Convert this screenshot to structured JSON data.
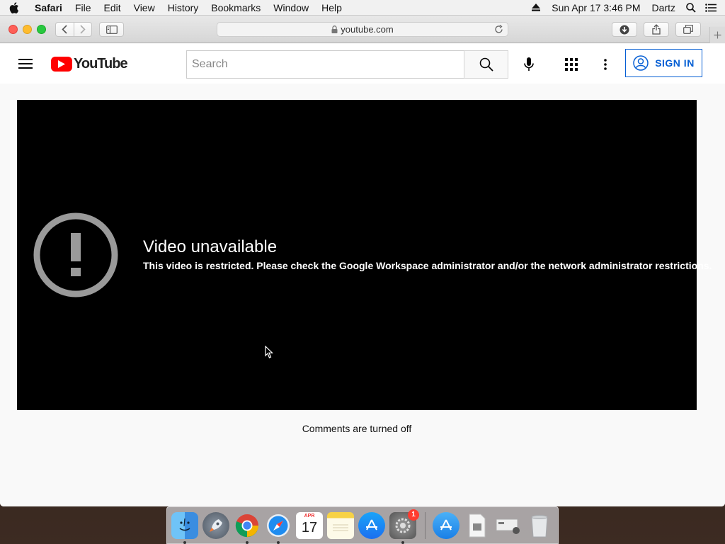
{
  "menubar": {
    "app_name": "Safari",
    "items": [
      "File",
      "Edit",
      "View",
      "History",
      "Bookmarks",
      "Window",
      "Help"
    ],
    "datetime": "Sun Apr 17  3:46 PM",
    "user": "Dartz",
    "icons": [
      "apple-icon",
      "eject-icon",
      "spotlight-icon",
      "notification-center-icon"
    ]
  },
  "browser": {
    "url": "youtube.com",
    "toolbar_icons": [
      "back-icon",
      "forward-icon",
      "sidebar-icon",
      "lock-icon",
      "reload-icon",
      "download-icon",
      "share-icon",
      "tabs-icon",
      "new-tab-icon"
    ]
  },
  "youtube": {
    "logo_text": "YouTube",
    "search_placeholder": "Search",
    "signin_label": "SIGN IN",
    "brand_color": "#ff0000",
    "link_color": "#065fd4"
  },
  "player": {
    "error_title": "Video unavailable",
    "error_message": "This video is restricted. Please check the Google Workspace administrator and/or the network administrator restrictions."
  },
  "comments_status": "Comments are turned off",
  "dock": {
    "calendar_month": "APR",
    "calendar_day": "17",
    "settings_badge": "1",
    "apps": [
      "finder-icon",
      "launchpad-icon",
      "chrome-icon",
      "safari-icon",
      "calendar-icon",
      "notes-icon",
      "app-store-icon",
      "system-preferences-icon",
      "applications-folder-icon",
      "documents-icon",
      "downloads-icon",
      "trash-icon"
    ]
  }
}
